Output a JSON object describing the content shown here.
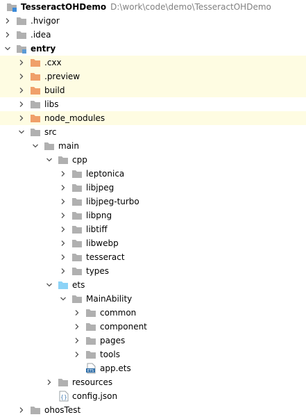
{
  "project": {
    "name": "TesseractOHDemo",
    "path": "D:\\work\\code\\demo\\TesseractOHDemo"
  },
  "colors": {
    "folder": "#b0b0b0",
    "excluded_folder": "#f0a06a",
    "source_folder": "#8cd3f7",
    "module_folder": "#5b9bd5",
    "highlight_row": "#fefce2",
    "path_text": "#808080"
  },
  "rows": [
    {
      "label": ".hvigor",
      "icon": "folder-icon",
      "state": "collapsed"
    },
    {
      "label": ".idea",
      "icon": "folder-icon",
      "state": "collapsed"
    },
    {
      "label": "entry",
      "icon": "module-folder-icon",
      "state": "expanded"
    },
    {
      "label": ".cxx",
      "icon": "excluded-folder-icon",
      "state": "collapsed"
    },
    {
      "label": ".preview",
      "icon": "excluded-folder-icon",
      "state": "collapsed"
    },
    {
      "label": "build",
      "icon": "excluded-folder-icon",
      "state": "collapsed"
    },
    {
      "label": "libs",
      "icon": "folder-icon",
      "state": "collapsed"
    },
    {
      "label": "node_modules",
      "icon": "excluded-folder-icon",
      "state": "collapsed"
    },
    {
      "label": "src",
      "icon": "folder-icon",
      "state": "expanded"
    },
    {
      "label": "main",
      "icon": "folder-icon",
      "state": "expanded"
    },
    {
      "label": "cpp",
      "icon": "folder-icon",
      "state": "expanded"
    },
    {
      "label": "leptonica",
      "icon": "folder-icon",
      "state": "collapsed"
    },
    {
      "label": "libjpeg",
      "icon": "folder-icon",
      "state": "collapsed"
    },
    {
      "label": "libjpeg-turbo",
      "icon": "folder-icon",
      "state": "collapsed"
    },
    {
      "label": "libpng",
      "icon": "folder-icon",
      "state": "collapsed"
    },
    {
      "label": "libtiff",
      "icon": "folder-icon",
      "state": "collapsed"
    },
    {
      "label": "libwebp",
      "icon": "folder-icon",
      "state": "collapsed"
    },
    {
      "label": "tesseract",
      "icon": "folder-icon",
      "state": "collapsed"
    },
    {
      "label": "types",
      "icon": "folder-icon",
      "state": "collapsed"
    },
    {
      "label": "ets",
      "icon": "source-folder-icon",
      "state": "expanded"
    },
    {
      "label": "MainAbility",
      "icon": "folder-icon",
      "state": "expanded"
    },
    {
      "label": "common",
      "icon": "folder-icon",
      "state": "collapsed"
    },
    {
      "label": "component",
      "icon": "folder-icon",
      "state": "collapsed"
    },
    {
      "label": "pages",
      "icon": "folder-icon",
      "state": "collapsed"
    },
    {
      "label": "tools",
      "icon": "folder-icon",
      "state": "collapsed"
    },
    {
      "label": "app.ets",
      "icon": "ets-file-icon",
      "state": "leaf"
    },
    {
      "label": "resources",
      "icon": "folder-icon",
      "state": "collapsed"
    },
    {
      "label": "config.json",
      "icon": "json-file-icon",
      "state": "leaf"
    },
    {
      "label": "ohosTest",
      "icon": "folder-icon",
      "state": "collapsed"
    }
  ]
}
